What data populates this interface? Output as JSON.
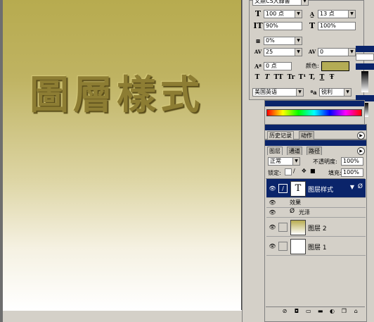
{
  "document": {
    "title_text": "圖層樣式",
    "gradient_top": "#b7ab4f",
    "gradient_bottom": "#ffffff"
  },
  "character": {
    "font_style": "文鼎CS大隸書",
    "font_size": "100 点",
    "leading": "13 点",
    "vertical_scale": "90%",
    "horizontal_scale": "100%",
    "tracking_ratio": "0%",
    "kerning": "25",
    "tracking": "0",
    "baseline_shift": "0 点",
    "color_label": "颜色:",
    "color_value": "#b4ac55",
    "language": "美国英语",
    "antialias": "锐利",
    "style_buttons": [
      "T",
      "T",
      "TT",
      "Tr",
      "T¹",
      "T,",
      "T",
      "Ŧ"
    ]
  },
  "history": {
    "tabs": [
      "历史记录",
      "动作"
    ]
  },
  "layers": {
    "tabs": [
      "图层",
      "通道",
      "路径"
    ],
    "blend_mode": "正常",
    "opacity_label": "不透明度:",
    "opacity_value": "100%",
    "lock_label": "锁定:",
    "fill_label": "填充:",
    "fill_value": "100%",
    "items": [
      {
        "name": "图层样式",
        "type": "text",
        "selected": true
      },
      {
        "name": "效果",
        "type": "effects"
      },
      {
        "name": "光泽",
        "type": "effect"
      },
      {
        "name": "图层 2",
        "type": "gradient"
      },
      {
        "name": "图层 1",
        "type": "white"
      }
    ],
    "bottom_icons": [
      "link-icon",
      "style-icon",
      "mask-icon",
      "folder-icon",
      "adjustment-icon",
      "new-layer-icon",
      "trash-icon"
    ]
  },
  "colors": {
    "selection": "#0a246a",
    "panel": "#d4d0c8"
  }
}
